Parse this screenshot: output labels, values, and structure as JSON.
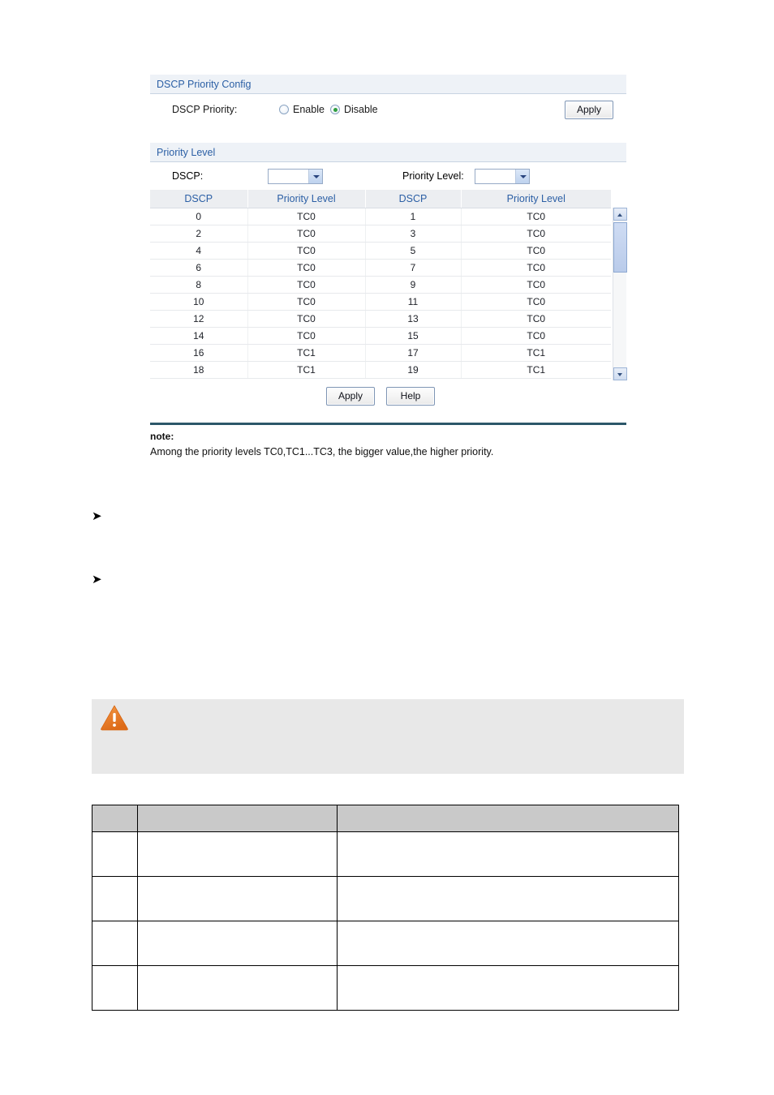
{
  "panel": {
    "dscp_config": {
      "section_title": "DSCP Priority Config",
      "field_label": "DSCP Priority:",
      "options": [
        {
          "label": "Enable",
          "selected": false
        },
        {
          "label": "Disable",
          "selected": true
        }
      ],
      "apply_label": "Apply"
    },
    "priority_level": {
      "section_title": "Priority Level",
      "dscp_select_label": "DSCP:",
      "dscp_select_value": "",
      "priority_select_label": "Priority Level:",
      "priority_select_value": "",
      "apply_label": "Apply",
      "help_label": "Help"
    },
    "note": {
      "title": "note:",
      "text": "Among the priority levels TC0,TC1...TC3, the bigger value,the higher priority."
    }
  },
  "table": {
    "headers": [
      "DSCP",
      "Priority Level",
      "DSCP",
      "Priority Level"
    ],
    "rows": [
      [
        "0",
        "TC0",
        "1",
        "TC0"
      ],
      [
        "2",
        "TC0",
        "3",
        "TC0"
      ],
      [
        "4",
        "TC0",
        "5",
        "TC0"
      ],
      [
        "6",
        "TC0",
        "7",
        "TC0"
      ],
      [
        "8",
        "TC0",
        "9",
        "TC0"
      ],
      [
        "10",
        "TC0",
        "11",
        "TC0"
      ],
      [
        "12",
        "TC0",
        "13",
        "TC0"
      ],
      [
        "14",
        "TC0",
        "15",
        "TC0"
      ],
      [
        "16",
        "TC1",
        "17",
        "TC1"
      ],
      [
        "18",
        "TC1",
        "19",
        "TC1"
      ]
    ]
  },
  "bullets": [
    {
      "glyph": "➤"
    },
    {
      "glyph": "➤"
    }
  ],
  "caution": {
    "icon": "warning-triangle",
    "text": ""
  },
  "bottom_table": {
    "headers": [
      "",
      "",
      ""
    ],
    "rows": [
      [
        "",
        "",
        ""
      ],
      [
        "",
        "",
        ""
      ],
      [
        "",
        "",
        ""
      ],
      [
        "",
        "",
        ""
      ]
    ]
  },
  "colors": {
    "section_header_bg": "#eef2f7",
    "section_header_text": "#2b5fa5",
    "table_header_bg": "#eceef1",
    "divider": "#2c5769",
    "warning_orange": "#e87722",
    "bottom_table_header_bg": "#c9c9c9"
  }
}
